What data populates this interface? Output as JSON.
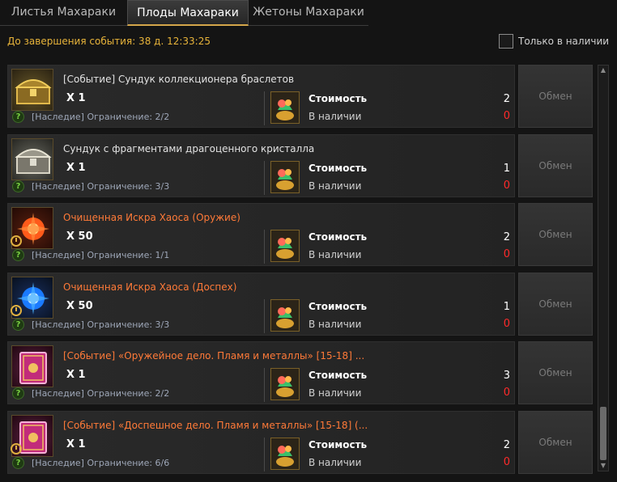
{
  "tabs": [
    "Листья Махараки",
    "Плоды Махараки",
    "Жетоны Махараки"
  ],
  "event_timer": "До завершения события: 38 д. 12:33:25",
  "filter": {
    "label": "Только в наличии",
    "checked": false
  },
  "cost_label": "Стоимость",
  "stock_label": "В наличии",
  "exchange_label": "Обмен",
  "items": [
    {
      "name": "[Событие] Сундук коллекционера браслетов",
      "name_color": "white",
      "icon": "gold-chest-icon",
      "timed": false,
      "qty": "X 1",
      "limit": "[Наследие] Ограничение: 2/2",
      "cost": "2",
      "stock": "0"
    },
    {
      "name": "Сундук с фрагментами драгоценного кристалла",
      "name_color": "white",
      "icon": "silver-chest-icon",
      "timed": false,
      "qty": "X 1",
      "limit": "[Наследие] Ограничение: 3/3",
      "cost": "1",
      "stock": "0"
    },
    {
      "name": "Очищенная Искра Хаоса (Оружие)",
      "name_color": "orange",
      "icon": "red-spark-icon",
      "timed": true,
      "qty": "X 50",
      "limit": "[Наследие] Ограничение: 1/1",
      "cost": "2",
      "stock": "0"
    },
    {
      "name": "Очищенная Искра Хаоса (Доспех)",
      "name_color": "orange",
      "icon": "blue-spark-icon",
      "timed": true,
      "qty": "X 50",
      "limit": "[Наследие] Ограничение: 3/3",
      "cost": "1",
      "stock": "0"
    },
    {
      "name": "[Событие] «Оружейное дело. Пламя и металлы» [15-18] ...",
      "name_color": "orange",
      "icon": "pink-book-icon",
      "timed": false,
      "qty": "X 1",
      "limit": "[Наследие] Ограничение: 2/2",
      "cost": "3",
      "stock": "0"
    },
    {
      "name": "[Событие] «Доспешное дело. Пламя и металлы» [15-18] (...",
      "name_color": "orange",
      "icon": "pink-book-icon",
      "timed": true,
      "qty": "X 1",
      "limit": "[Наследие] Ограничение: 6/6",
      "cost": "2",
      "stock": "0"
    }
  ]
}
